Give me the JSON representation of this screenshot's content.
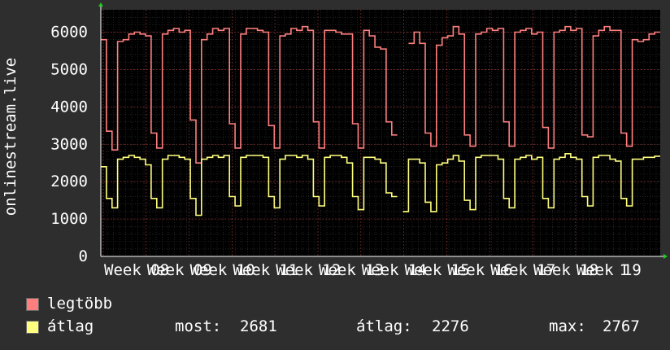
{
  "chart_data": {
    "type": "line",
    "ylabel": "onlinestream.live",
    "ylim": [
      0,
      6600
    ],
    "yticks": [
      0,
      1000,
      2000,
      3000,
      4000,
      5000,
      6000
    ],
    "xlim": [
      0,
      12
    ],
    "x_tick_labels": [
      "Week 08",
      "Week 09",
      "Week 10",
      "Week 11",
      "Week 12",
      "Week 13",
      "Week 14",
      "Week 15",
      "Week 16",
      "Week 17",
      "Week 18",
      "Week 19",
      "1"
    ],
    "grid": true,
    "background": "#000000",
    "series": [
      {
        "name": "legtöbb",
        "color": "#ff7f7f",
        "values": [
          5800,
          3350,
          2850,
          5750,
          5800,
          5950,
          6000,
          5950,
          5900,
          3300,
          2900,
          5950,
          6050,
          6100,
          6000,
          6050,
          3650,
          2500,
          5800,
          5950,
          6100,
          6050,
          6100,
          3550,
          2900,
          5950,
          6100,
          6100,
          6050,
          6000,
          3500,
          2900,
          5900,
          5950,
          6100,
          6050,
          6150,
          6050,
          3600,
          2900,
          6050,
          6050,
          6000,
          5950,
          5950,
          3550,
          2900,
          6050,
          5900,
          5600,
          5550,
          3600,
          3250,
          null,
          null,
          5700,
          6000,
          5700,
          3300,
          2950,
          5650,
          5850,
          5900,
          6150,
          5950,
          3250,
          2950,
          5950,
          6000,
          6100,
          6050,
          6100,
          3600,
          2950,
          6000,
          6050,
          6100,
          5950,
          6000,
          3450,
          2900,
          6000,
          6050,
          6150,
          6050,
          6100,
          3250,
          3200,
          5900,
          6050,
          6150,
          6050,
          6050,
          3300,
          2950,
          5800,
          5750,
          5800,
          5950,
          6000
        ]
      },
      {
        "name": "átlag",
        "color": "#ffff7f",
        "values": [
          2400,
          1550,
          1300,
          2600,
          2650,
          2700,
          2650,
          2600,
          2450,
          1550,
          1300,
          2600,
          2700,
          2700,
          2650,
          2600,
          1550,
          1100,
          2600,
          2650,
          2700,
          2650,
          2700,
          1600,
          1350,
          2650,
          2700,
          2700,
          2700,
          2650,
          1600,
          1300,
          2600,
          2700,
          2700,
          2650,
          2700,
          2600,
          1600,
          1350,
          2650,
          2700,
          2700,
          2650,
          2500,
          1600,
          1250,
          2650,
          2650,
          2600,
          2500,
          1700,
          1600,
          null,
          1200,
          2600,
          2600,
          2500,
          1450,
          1200,
          2450,
          2500,
          2600,
          2700,
          2550,
          1500,
          1250,
          2650,
          2700,
          2700,
          2700,
          2600,
          1550,
          1300,
          2600,
          2650,
          2700,
          2600,
          2650,
          1550,
          1300,
          2600,
          2650,
          2750,
          2650,
          2600,
          1600,
          1350,
          2650,
          2700,
          2700,
          2600,
          2550,
          1550,
          1350,
          2600,
          2600,
          2650,
          2650,
          2681
        ]
      }
    ]
  },
  "legend": {
    "max_label": "legtöbb",
    "avg_label": "átlag",
    "now_label": "most:",
    "now_value": "2681",
    "mean_label": "átlag:",
    "mean_value": "2276",
    "peak_label": "max:",
    "peak_value": "2767"
  }
}
